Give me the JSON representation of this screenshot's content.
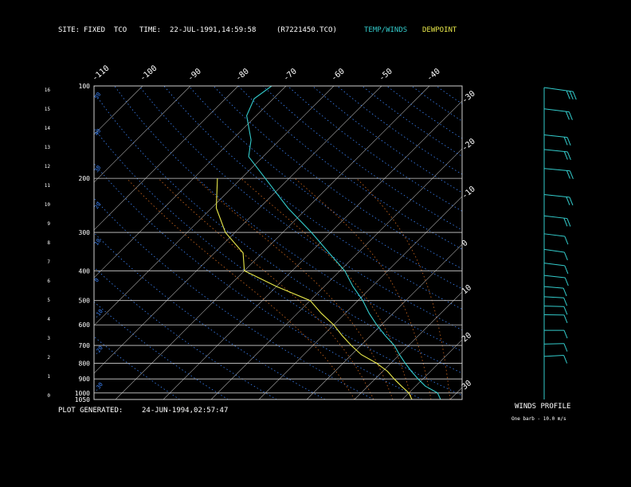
{
  "header": {
    "site_label": "SITE:",
    "site_value": "FIXED  TCO",
    "time_label": "TIME:",
    "time_value": "22-JUL-1991,14:59:58",
    "file_id": "(R7221450.TCO)",
    "legend_temp": "TEMP/WINDS",
    "legend_dew": "DEWPOINT"
  },
  "footer": {
    "generated_label": "PLOT GENERATED:",
    "generated_value": "24-JUN-1994,02:57:47"
  },
  "winds": {
    "title": "WINDS PROFILE",
    "note": "One barb - 10.0 m/s"
  },
  "colors": {
    "temp": "#33cccc",
    "dewpoint": "#e8e84a",
    "isobar": "#cfcfcf",
    "isotherm": "#aaaaaa",
    "dry_adiabat": "#3b82f6",
    "moist_adiabat": "#d2691e",
    "axis_text": "#ffffff"
  },
  "chart_data": {
    "type": "skew-t log-p",
    "pressure_ticks": [
      "100",
      "200",
      "300",
      "400",
      "500",
      "600",
      "700",
      "800",
      "900",
      "1000",
      "1050"
    ],
    "pressure_values": [
      100,
      200,
      300,
      400,
      500,
      600,
      700,
      800,
      900,
      1000,
      1050
    ],
    "height_ticks": [
      "16",
      "15",
      "14",
      "13",
      "12",
      "11",
      "10",
      "9",
      "8",
      "7",
      "6",
      "5",
      "4",
      "3",
      "2",
      "1",
      "0"
    ],
    "top_temp_ticks": [
      "-110",
      "-100",
      "-90",
      "-80",
      "-70",
      "-60",
      "-50",
      "-40"
    ],
    "right_temp_ticks": [
      "-30",
      "-20",
      "-10",
      "0",
      "10",
      "20",
      "30"
    ],
    "dry_adiabat_labels": [
      "50",
      "40",
      "30",
      "20",
      "10",
      "0",
      "-10",
      "-20",
      "-30"
    ],
    "temperature_profile": [
      {
        "p": 1050,
        "t": 28
      },
      {
        "p": 1000,
        "t": 26
      },
      {
        "p": 950,
        "t": 22
      },
      {
        "p": 900,
        "t": 19
      },
      {
        "p": 850,
        "t": 16
      },
      {
        "p": 800,
        "t": 13
      },
      {
        "p": 750,
        "t": 10
      },
      {
        "p": 700,
        "t": 7
      },
      {
        "p": 650,
        "t": 3
      },
      {
        "p": 600,
        "t": -1
      },
      {
        "p": 550,
        "t": -5
      },
      {
        "p": 500,
        "t": -9
      },
      {
        "p": 450,
        "t": -14
      },
      {
        "p": 400,
        "t": -19
      },
      {
        "p": 350,
        "t": -26
      },
      {
        "p": 300,
        "t": -34
      },
      {
        "p": 250,
        "t": -44
      },
      {
        "p": 200,
        "t": -55
      },
      {
        "p": 170,
        "t": -63
      },
      {
        "p": 150,
        "t": -66
      },
      {
        "p": 125,
        "t": -72
      },
      {
        "p": 110,
        "t": -74
      },
      {
        "p": 100,
        "t": -73
      }
    ],
    "dewpoint_profile": [
      {
        "p": 1050,
        "t": 22
      },
      {
        "p": 1000,
        "t": 20
      },
      {
        "p": 950,
        "t": 17
      },
      {
        "p": 900,
        "t": 14
      },
      {
        "p": 850,
        "t": 11
      },
      {
        "p": 800,
        "t": 7
      },
      {
        "p": 750,
        "t": 2
      },
      {
        "p": 700,
        "t": -2
      },
      {
        "p": 650,
        "t": -6
      },
      {
        "p": 600,
        "t": -10
      },
      {
        "p": 550,
        "t": -15
      },
      {
        "p": 500,
        "t": -20
      },
      {
        "p": 450,
        "t": -30
      },
      {
        "p": 400,
        "t": -40
      },
      {
        "p": 350,
        "t": -44
      },
      {
        "p": 300,
        "t": -52
      },
      {
        "p": 250,
        "t": -59
      },
      {
        "p": 200,
        "t": -65
      }
    ],
    "wind_profile": [
      {
        "p": 100,
        "dir": 280,
        "spd": 30
      },
      {
        "p": 120,
        "dir": 270,
        "spd": 20
      },
      {
        "p": 150,
        "dir": 260,
        "spd": 15
      },
      {
        "p": 170,
        "dir": 255,
        "spd": 15
      },
      {
        "p": 200,
        "dir": 250,
        "spd": 20
      },
      {
        "p": 250,
        "dir": 260,
        "spd": 20
      },
      {
        "p": 300,
        "dir": 265,
        "spd": 15
      },
      {
        "p": 350,
        "dir": 270,
        "spd": 10
      },
      {
        "p": 400,
        "dir": 280,
        "spd": 10
      },
      {
        "p": 450,
        "dir": 270,
        "spd": 10
      },
      {
        "p": 500,
        "dir": 260,
        "spd": 10
      },
      {
        "p": 550,
        "dir": 240,
        "spd": 5
      },
      {
        "p": 600,
        "dir": 220,
        "spd": 5
      },
      {
        "p": 650,
        "dir": 200,
        "spd": 5
      },
      {
        "p": 700,
        "dir": 190,
        "spd": 5
      },
      {
        "p": 800,
        "dir": 180,
        "spd": 5
      },
      {
        "p": 900,
        "dir": 160,
        "spd": 5
      },
      {
        "p": 1000,
        "dir": 140,
        "spd": 5
      }
    ]
  }
}
